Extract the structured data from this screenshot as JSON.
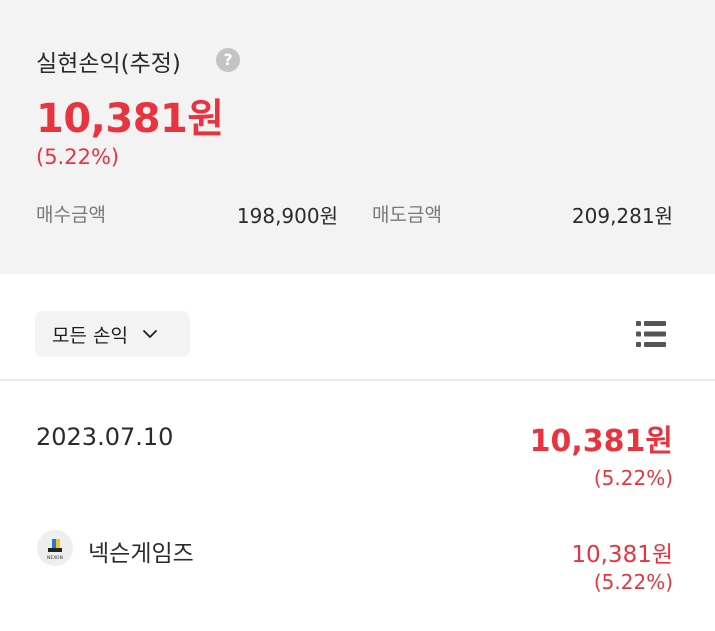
{
  "summary": {
    "title": "실현손익(추정)",
    "help_symbol": "?",
    "total_amount": "10,381원",
    "total_percent": "(5.22%)",
    "buy_label": "매수금액",
    "buy_value": "198,900원",
    "sell_label": "매도금액",
    "sell_value": "209,281원"
  },
  "filter": {
    "label": "모든 손익",
    "icon": "chevron-down-icon"
  },
  "view_toggle": {
    "icon": "list-icon"
  },
  "records": [
    {
      "date": "2023.07.10",
      "amount": "10,381원",
      "percent": "(5.22%)",
      "stocks": [
        {
          "name": "넥슨게임즈",
          "logo_text": "NEXON",
          "amount": "10,381원",
          "percent": "(5.22%)"
        }
      ]
    }
  ],
  "colors": {
    "profit": "#e8343e",
    "summary_bg": "#f3f3f4",
    "text": "#2b2b2b",
    "muted": "#7a7a7d"
  }
}
